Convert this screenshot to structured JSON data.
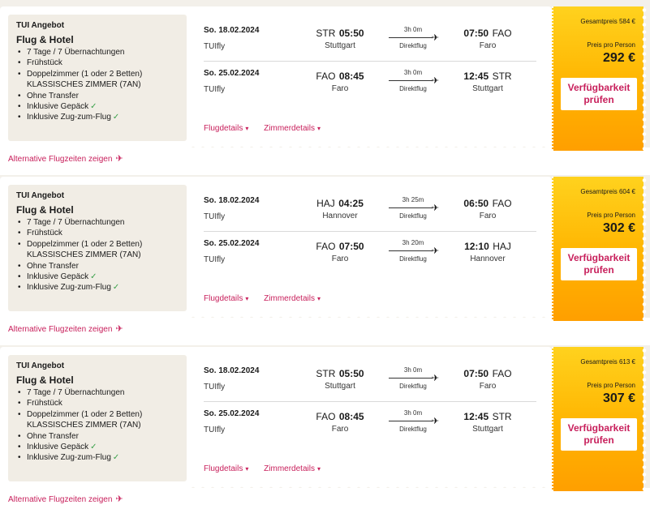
{
  "offers": [
    {
      "supplier": "TUI Angebot",
      "title": "Flug & Hotel",
      "features": [
        "7 Tage / 7 Übernachtungen",
        "Frühstück",
        "Doppelzimmer (1 oder 2 Betten)",
        "KLASSISCHES ZIMMER (7AN)",
        "Ohne Transfer",
        "Inklusive Gepäck",
        "Inklusive Zug-zum-Flug"
      ],
      "outbound": {
        "date": "So. 18.02.2024",
        "airline": "TUIfly",
        "dep_code": "STR",
        "dep_time": "05:50",
        "dep_city": "Stuttgart",
        "duration": "3h 0m",
        "kind": "Direktflug",
        "arr_time": "07:50",
        "arr_code": "FAO",
        "arr_city": "Faro"
      },
      "inbound": {
        "date": "So. 25.02.2024",
        "airline": "TUIfly",
        "dep_code": "FAO",
        "dep_time": "08:45",
        "dep_city": "Faro",
        "duration": "3h 0m",
        "kind": "Direktflug",
        "arr_time": "12:45",
        "arr_code": "STR",
        "arr_city": "Stuttgart"
      },
      "total": "Gesamtpreis 584 €",
      "per_person_label": "Preis pro Person",
      "per_person": "292 €"
    },
    {
      "supplier": "TUI Angebot",
      "title": "Flug & Hotel",
      "features": [
        "7 Tage / 7 Übernachtungen",
        "Frühstück",
        "Doppelzimmer (1 oder 2 Betten)",
        "KLASSISCHES ZIMMER (7AN)",
        "Ohne Transfer",
        "Inklusive Gepäck",
        "Inklusive Zug-zum-Flug"
      ],
      "outbound": {
        "date": "So. 18.02.2024",
        "airline": "TUIfly",
        "dep_code": "HAJ",
        "dep_time": "04:25",
        "dep_city": "Hannover",
        "duration": "3h 25m",
        "kind": "Direktflug",
        "arr_time": "06:50",
        "arr_code": "FAO",
        "arr_city": "Faro"
      },
      "inbound": {
        "date": "So. 25.02.2024",
        "airline": "TUIfly",
        "dep_code": "FAO",
        "dep_time": "07:50",
        "dep_city": "Faro",
        "duration": "3h 20m",
        "kind": "Direktflug",
        "arr_time": "12:10",
        "arr_code": "HAJ",
        "arr_city": "Hannover"
      },
      "total": "Gesamtpreis 604 €",
      "per_person_label": "Preis pro Person",
      "per_person": "302 €"
    },
    {
      "supplier": "TUI Angebot",
      "title": "Flug & Hotel",
      "features": [
        "7 Tage / 7 Übernachtungen",
        "Frühstück",
        "Doppelzimmer (1 oder 2 Betten)",
        "KLASSISCHES ZIMMER (7AN)",
        "Ohne Transfer",
        "Inklusive Gepäck",
        "Inklusive Zug-zum-Flug"
      ],
      "outbound": {
        "date": "So. 18.02.2024",
        "airline": "TUIfly",
        "dep_code": "STR",
        "dep_time": "05:50",
        "dep_city": "Stuttgart",
        "duration": "3h 0m",
        "kind": "Direktflug",
        "arr_time": "07:50",
        "arr_code": "FAO",
        "arr_city": "Faro"
      },
      "inbound": {
        "date": "So. 25.02.2024",
        "airline": "TUIfly",
        "dep_code": "FAO",
        "dep_time": "08:45",
        "dep_city": "Faro",
        "duration": "3h 0m",
        "kind": "Direktflug",
        "arr_time": "12:45",
        "arr_code": "STR",
        "arr_city": "Stuttgart"
      },
      "total": "Gesamtpreis 613 €",
      "per_person_label": "Preis pro Person",
      "per_person": "307 €"
    }
  ],
  "labels": {
    "check_availability": "Verfügbarkeit prüfen",
    "flight_details": "Flugdetails",
    "room_details": "Zimmerdetails",
    "alt_flights": "Alternative Flugzeiten zeigen"
  },
  "icons": {
    "plane": "plane-icon",
    "chevron": "chevron-down-icon",
    "check": "check-icon"
  },
  "colors": {
    "accent": "#c8205c",
    "price_bg": "#ffb400",
    "check": "#3aa04a",
    "page_bg": "#f3f0ea"
  }
}
